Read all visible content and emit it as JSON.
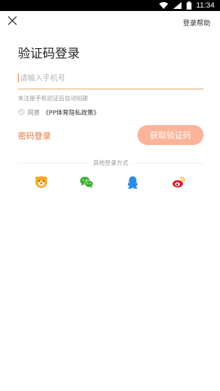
{
  "status_bar": {
    "time": "11:34",
    "icons": [
      "wifi-icon",
      "signal-icon",
      "battery-icon"
    ]
  },
  "header": {
    "close_icon": "close-icon",
    "help_label": "登录帮助"
  },
  "title": "验证码登录",
  "phone_field": {
    "value": "",
    "placeholder": "请输入手机号"
  },
  "hint": "未注册手机验证后自动创建",
  "agreement": {
    "prefix": "同意",
    "policy": "《PP体育隐私政策》"
  },
  "password_login_label": "密码登录",
  "get_code_label": "获取验证码",
  "other_login_label": "其他登录方式",
  "social_logins": [
    "suning-icon",
    "wechat-icon",
    "qq-icon",
    "weibo-icon"
  ],
  "colors": {
    "accent": "#e9713a",
    "button_bg": "#f9b49a",
    "input_underline": "#e9a15f"
  }
}
